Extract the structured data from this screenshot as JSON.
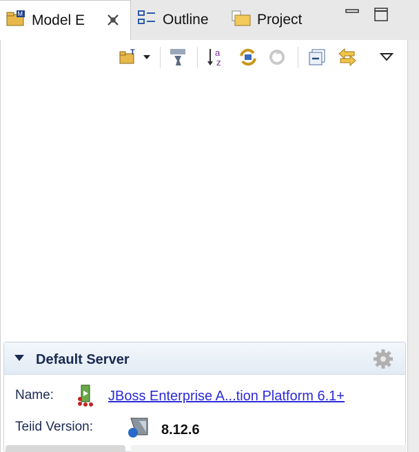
{
  "tabs": [
    {
      "label": "Model E",
      "icon": "model-explorer-icon",
      "active": true
    },
    {
      "label": "Outline",
      "icon": "outline-icon",
      "active": false
    },
    {
      "label": "Project",
      "icon": "project-folder-icon",
      "active": false
    }
  ],
  "window_controls": [
    "minimize-icon",
    "maximize-icon"
  ],
  "toolbar": {
    "buttons": [
      "new-model-folder-icon",
      "dropdown-arrow-icon",
      "filter-icon",
      "sort-alpha-icon",
      "sync-icon",
      "refresh-disabled-icon",
      "collapse-all-icon",
      "link-editor-icon",
      "view-menu-icon"
    ]
  },
  "server_section": {
    "title": "Default Server",
    "name_label": "Name:",
    "name_value": "JBoss Enterprise A...tion Platform 6.1+ ",
    "version_label": "Teiid Version:",
    "version_value": "8.12.6"
  },
  "colors": {
    "link": "#2a2ad8",
    "section_title": "#1a2a52"
  }
}
